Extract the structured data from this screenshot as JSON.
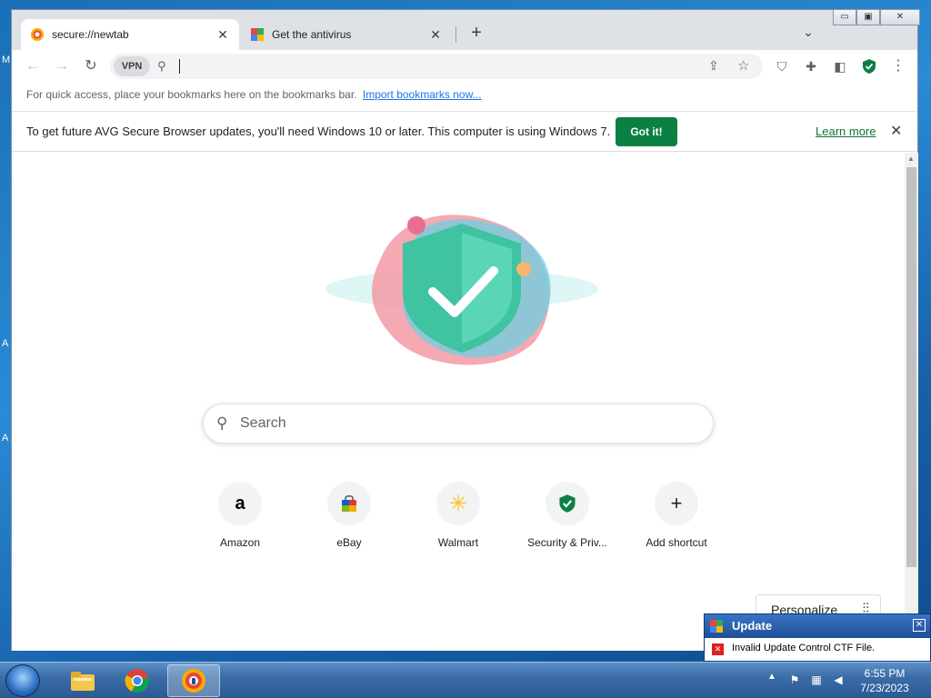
{
  "browser": {
    "tabs": [
      {
        "title": "secure://newtab",
        "active": true
      },
      {
        "title": "Get the antivirus",
        "active": false
      }
    ],
    "window_controls": {
      "minimize": "▭",
      "maximize": "▣",
      "close": "✕"
    },
    "omnibox": {
      "vpn_label": "VPN",
      "value": ""
    },
    "bookmarks_bar": {
      "text": "For quick access, place your bookmarks here on the bookmarks bar.",
      "link": "Import bookmarks now..."
    },
    "infobar": {
      "message": "To get future AVG Secure Browser updates, you'll need Windows 10 or later. This computer is using Windows 7.",
      "button": "Got it!",
      "link": "Learn more"
    },
    "accent_color": "#0b8043"
  },
  "newtab": {
    "search_placeholder": "Search",
    "shortcuts": [
      {
        "label": "Amazon",
        "icon": "amazon-icon"
      },
      {
        "label": "eBay",
        "icon": "ebay-bag-icon"
      },
      {
        "label": "Walmart",
        "icon": "walmart-spark-icon"
      },
      {
        "label": "Security & Priv...",
        "icon": "shield-check-icon"
      },
      {
        "label": "Add shortcut",
        "icon": "plus-icon"
      }
    ],
    "personalize_label": "Personalize"
  },
  "popup": {
    "title": "Update",
    "message": "Invalid Update Control CTF File."
  },
  "taskbar": {
    "time": "6:55 PM",
    "date": "7/23/2023"
  },
  "desktop": {
    "letters": [
      "M",
      "A",
      "A"
    ]
  }
}
